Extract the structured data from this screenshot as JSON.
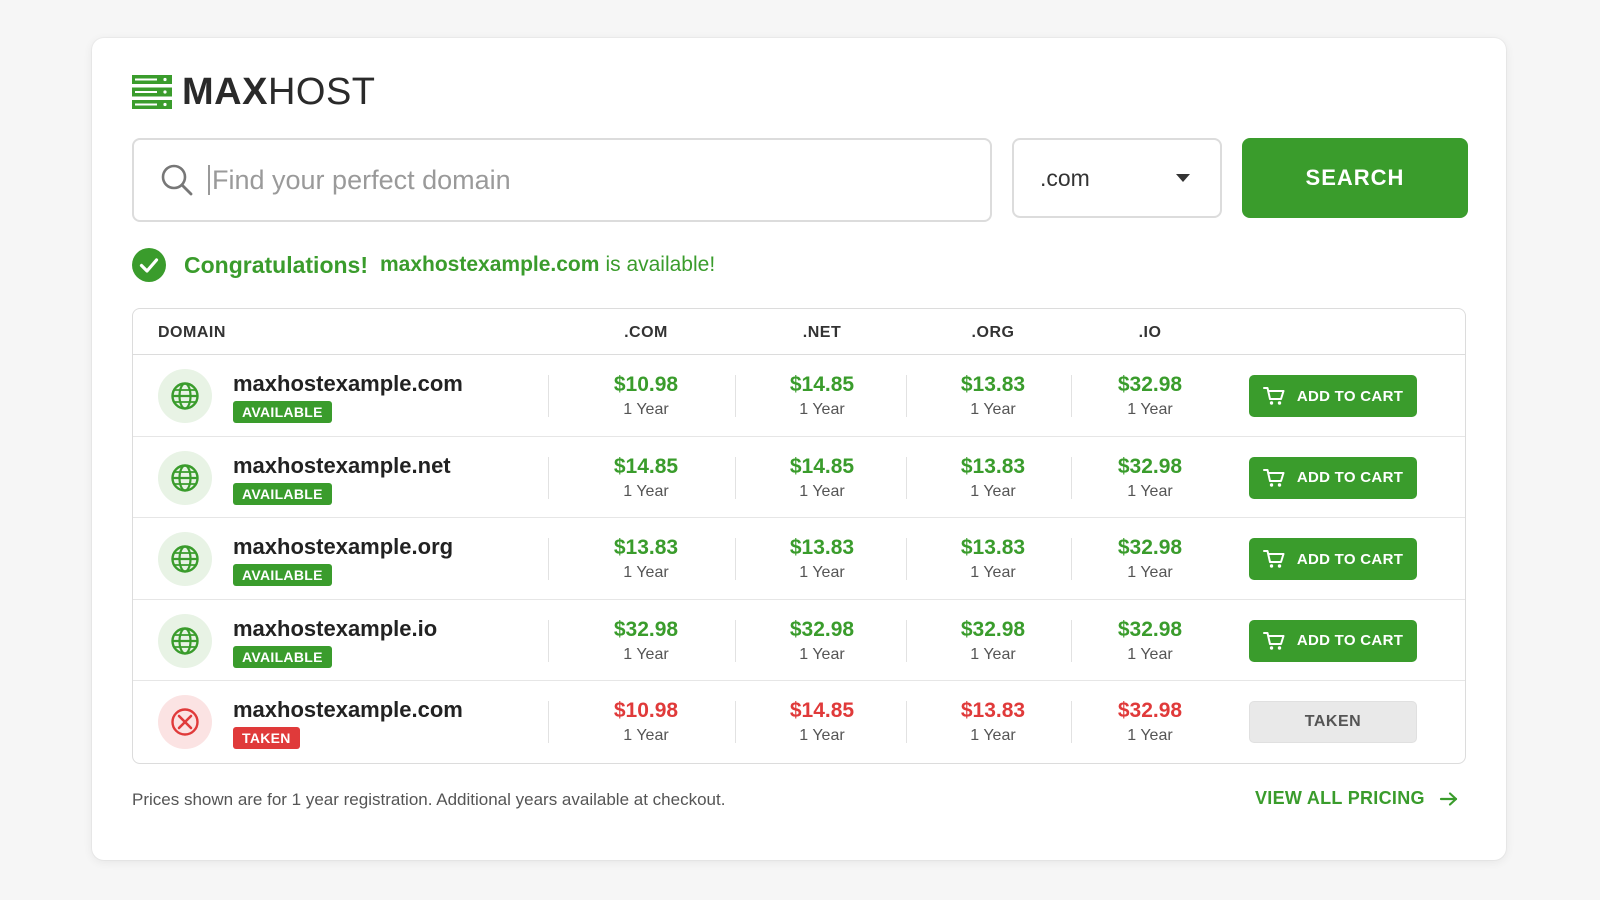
{
  "brand": {
    "bold": "MAX",
    "regular": "HOST"
  },
  "search": {
    "placeholder": "Find your perfect domain",
    "tld_value": ".com",
    "button_label": "SEARCH"
  },
  "availability": {
    "congrats": "Congratulations!",
    "domain": "maxhostexample.com",
    "suffix": "is available!"
  },
  "table": {
    "headers": {
      "domain": "DOMAIN",
      "com": ".COM",
      "net": ".NET",
      "org": ".ORG",
      "io": ".IO"
    },
    "rows": [
      {
        "domain": "maxhostexample.com",
        "status": "AVAILABLE",
        "prices": [
          "$10.98",
          "$14.85",
          "$13.83",
          "$32.98"
        ],
        "terms": [
          "1 Year",
          "1 Year",
          "1 Year",
          "1 Year"
        ],
        "action": "ADD TO CART"
      },
      {
        "domain": "maxhostexample.net",
        "status": "AVAILABLE",
        "prices": [
          "$14.85",
          "$14.85",
          "$13.83",
          "$32.98"
        ],
        "terms": [
          "1 Year",
          "1 Year",
          "1 Year",
          "1 Year"
        ],
        "action": "ADD TO CART"
      },
      {
        "domain": "maxhostexample.org",
        "status": "AVAILABLE",
        "prices": [
          "$13.83",
          "$13.83",
          "$13.83",
          "$32.98"
        ],
        "terms": [
          "1 Year",
          "1 Year",
          "1 Year",
          "1 Year"
        ],
        "action": "ADD TO CART"
      },
      {
        "domain": "maxhostexample.io",
        "status": "AVAILABLE",
        "prices": [
          "$32.98",
          "$32.98",
          "$32.98",
          "$32.98"
        ],
        "terms": [
          "1 Year",
          "1 Year",
          "1 Year",
          "1 Year"
        ],
        "action": "ADD TO CART"
      },
      {
        "domain": "maxhostexample.com",
        "status": "TAKEN",
        "prices": [
          "$10.98",
          "$14.85",
          "$13.83",
          "$32.98"
        ],
        "terms": [
          "1 Year",
          "1 Year",
          "1 Year",
          "1 Year"
        ],
        "action": "TAKEN"
      }
    ]
  },
  "footer": {
    "note": "Prices shown are for 1 year registration. Additional years available at checkout.",
    "link": "VIEW ALL PRICING"
  },
  "icons": {
    "logo": "server-stack-icon",
    "search": "search-icon",
    "caret": "chevron-down-icon",
    "check": "check-circle-icon",
    "globe": "globe-icon",
    "taken": "x-circle-icon",
    "cart": "cart-icon",
    "arrow": "arrow-right-icon"
  },
  "colors": {
    "accent": "#3a9c2c",
    "danger": "#e03a3a",
    "available_bg": "#e8f3e5",
    "taken_bg": "#fbe3e3"
  }
}
